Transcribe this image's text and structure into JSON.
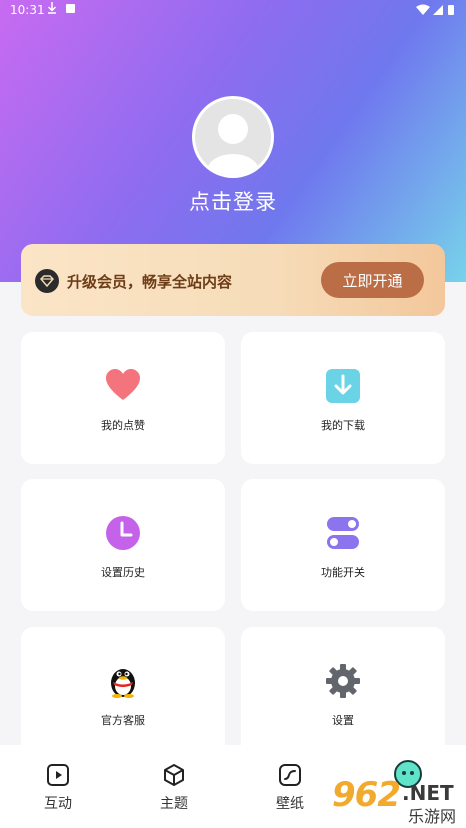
{
  "status_bar": {
    "time": "10:31"
  },
  "profile": {
    "login_text": "点击登录"
  },
  "vip": {
    "text": "升级会员，畅享全站内容",
    "button": "立即开通"
  },
  "cards": [
    {
      "label": "我的点赞",
      "icon": "heart-icon",
      "color": "#f3747c"
    },
    {
      "label": "我的下载",
      "icon": "download-icon",
      "color": "#6ad3e5"
    },
    {
      "label": "设置历史",
      "icon": "clock-icon",
      "color": "#c562ea"
    },
    {
      "label": "功能开关",
      "icon": "toggle-icon",
      "color": "#8d74ef"
    },
    {
      "label": "官方客服",
      "icon": "qq-penguin-icon",
      "color": "#111111"
    },
    {
      "label": "设置",
      "icon": "gear-icon",
      "color": "#62666c"
    }
  ],
  "nav": [
    {
      "label": "互动",
      "icon": "play-icon"
    },
    {
      "label": "主题",
      "icon": "cube-icon"
    },
    {
      "label": "壁纸",
      "icon": "wallpaper-icon"
    }
  ],
  "watermark": {
    "number": "962",
    "net": ".NET",
    "cn": "乐游网"
  }
}
